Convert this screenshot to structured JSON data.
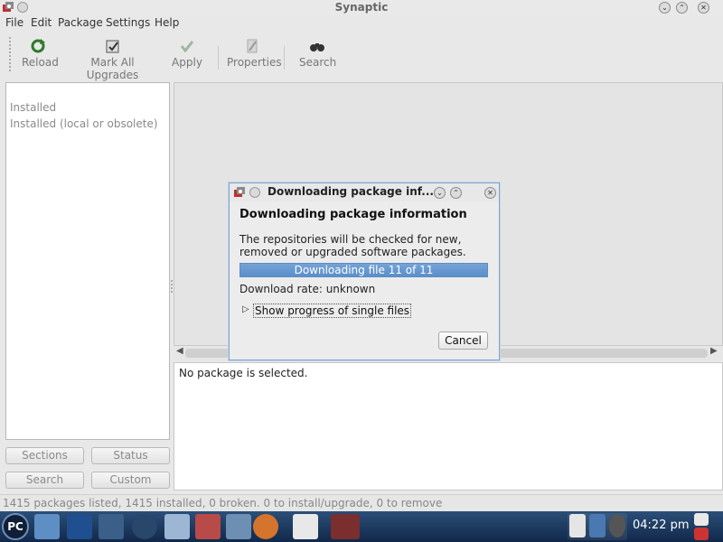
{
  "window": {
    "title": "Synaptic"
  },
  "menu": [
    "File",
    "Edit",
    "Package",
    "Settings",
    "Help"
  ],
  "toolbar": {
    "reload": "Reload",
    "mark_all_upgrades": "Mark All Upgrades",
    "apply": "Apply",
    "properties": "Properties",
    "search": "Search"
  },
  "filters": [
    "Installed",
    "Installed (local or obsolete)"
  ],
  "side_buttons": {
    "sections": "Sections",
    "status": "Status",
    "search": "Search",
    "custom": "Custom"
  },
  "details": {
    "text": "No package is selected."
  },
  "statusbar": {
    "text": "1415 packages listed, 1415 installed, 0 broken. 0 to install/upgrade, 0 to remove"
  },
  "dialog": {
    "title": "Downloading package inf...",
    "heading": "Downloading package information",
    "description": "The repositories will be checked for new, removed or upgraded software packages.",
    "progress_text": "Downloading file 11 of 11",
    "progress_fraction": 1.0,
    "rate": "Download rate: unknown",
    "expander_label": "Show progress of single files",
    "cancel": "Cancel"
  },
  "taskbar": {
    "clock": "04:22 pm",
    "logo": "PC"
  },
  "icons": {
    "app": "synaptic-icon",
    "reload": "reload-icon",
    "mark_all_upgrades": "mark-upgrades-icon",
    "apply": "apply-check-icon",
    "properties": "properties-icon",
    "search": "binoculars-icon"
  },
  "colors": {
    "accent": "#5a8fcb",
    "taskbar": "#1c3a60"
  }
}
